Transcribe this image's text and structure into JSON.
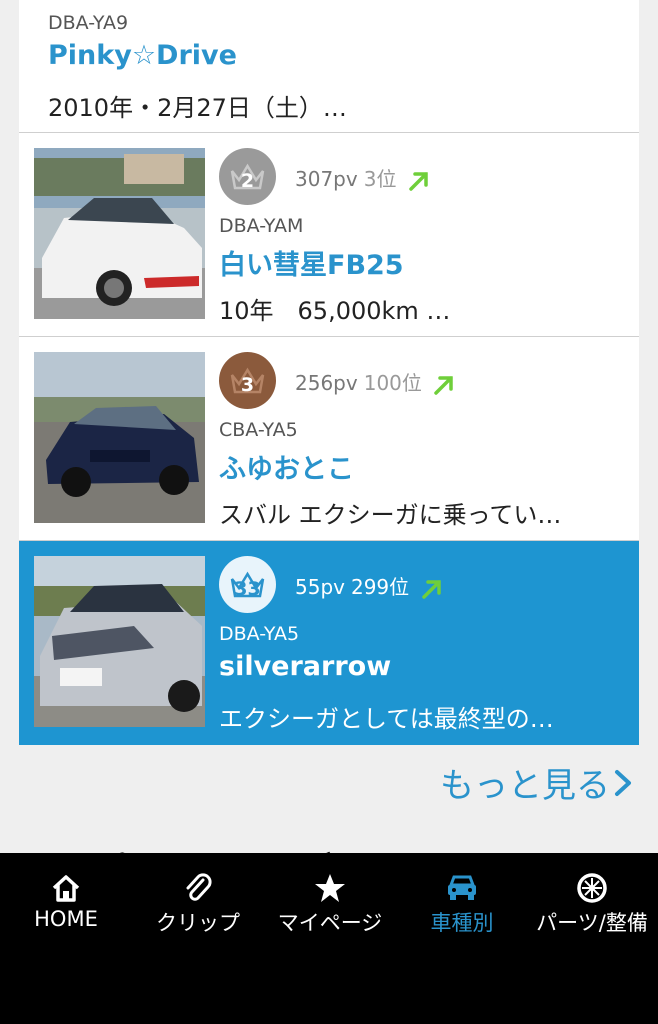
{
  "cards": [
    {
      "code": "DBA-YA9",
      "title": "Pinky☆Drive",
      "desc": "2010年・2月27日（土）…"
    },
    {
      "rank": "2",
      "pv": "307pv",
      "position": "3位",
      "code": "DBA-YAM",
      "title": "白い彗星FB25",
      "desc": "10年　65,000km …",
      "badge_color": "#9a9a9a"
    },
    {
      "rank": "3",
      "pv": "256pv",
      "position": "100位",
      "code": "CBA-YA5",
      "title": "ふゆおとこ",
      "desc": "スバル エクシーガに乗ってい…",
      "badge_color": "#8b5a3c"
    },
    {
      "rank": "33",
      "pv": "55pv",
      "position": "299位",
      "code": "DBA-YA5",
      "title": "silverarrow",
      "desc": "エクシーガとしては最終型の…",
      "badge_color": "#e8f4fb"
    }
  ],
  "more_label": "もっと見る",
  "section_peek": "パーツレビュー ランキング",
  "tabs": [
    {
      "label": "HOME",
      "icon": "home-icon"
    },
    {
      "label": "クリップ",
      "icon": "paperclip-icon"
    },
    {
      "label": "マイページ",
      "icon": "star-icon"
    },
    {
      "label": "車種別",
      "icon": "car-icon"
    },
    {
      "label": "パーツ/整備",
      "icon": "wheel-icon"
    }
  ],
  "colors": {
    "accent": "#2a93cc",
    "active_row": "#1e95d1",
    "trend_up": "#6fcf3a"
  }
}
